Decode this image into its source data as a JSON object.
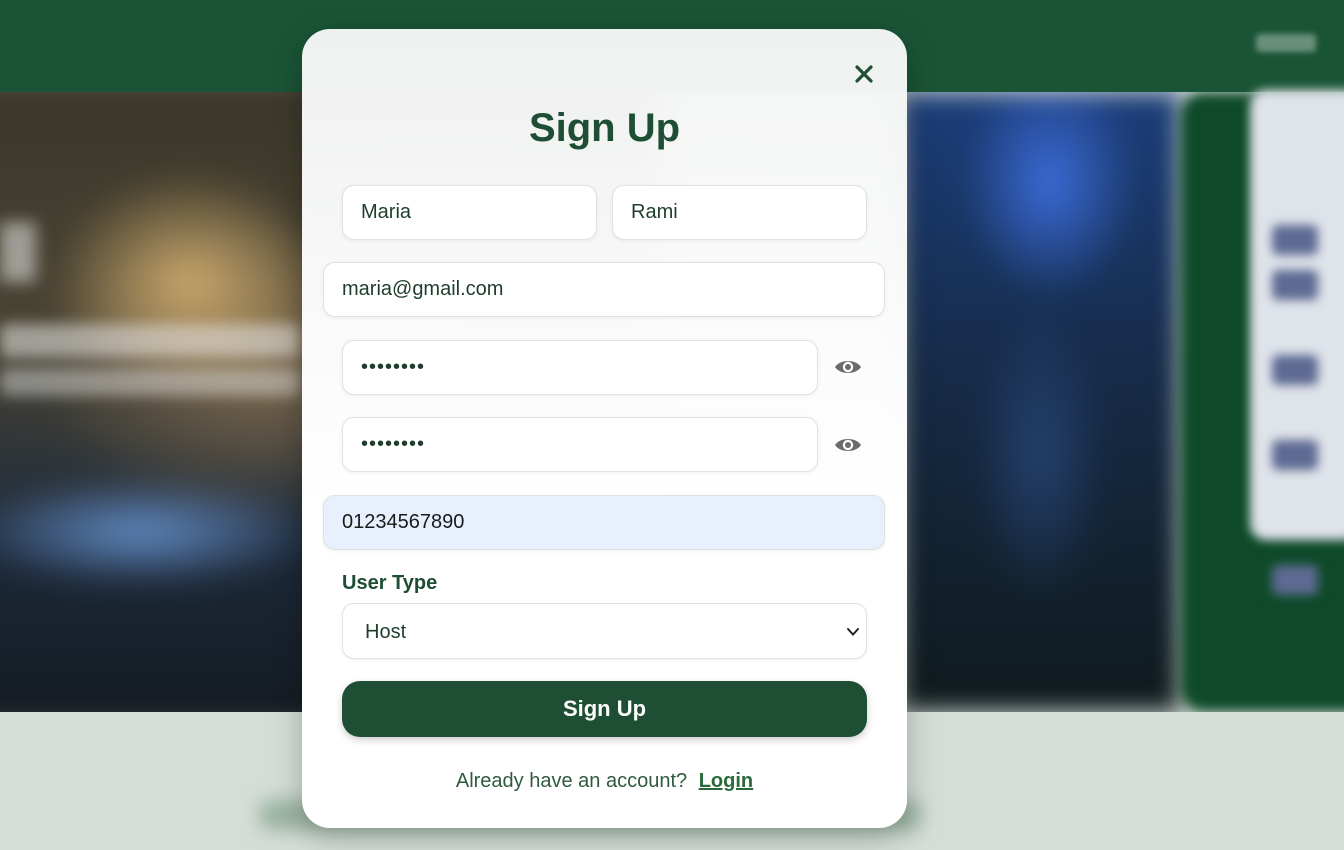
{
  "modal": {
    "title": "Sign Up",
    "close_icon": "close-icon",
    "fields": {
      "first_name": {
        "value": "Maria"
      },
      "last_name": {
        "value": "Rami"
      },
      "email": {
        "value": "maria@gmail.com"
      },
      "password": {
        "value": "••••••••",
        "toggle_icon": "eye-icon"
      },
      "confirm_password": {
        "value": "••••••••",
        "toggle_icon": "eye-icon"
      },
      "phone": {
        "value": "01234567890"
      }
    },
    "user_type": {
      "label": "User Type",
      "selected": "Host",
      "chevron_icon": "chevron-down-icon"
    },
    "submit_label": "Sign Up",
    "login_prompt": "Already have an account?",
    "login_link": "Login"
  },
  "colors": {
    "primary": "#1e4e33",
    "header_bg": "#1a5436",
    "autofill_bg": "#e8f0fe",
    "modal_bg": "#ffffff"
  }
}
